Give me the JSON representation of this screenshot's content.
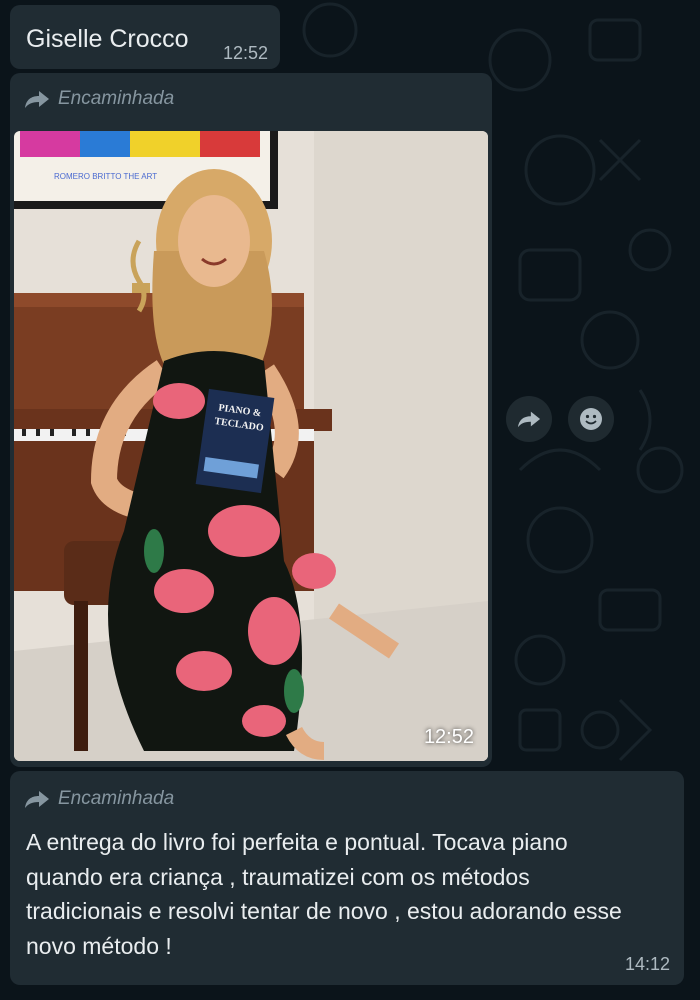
{
  "messages": [
    {
      "text": "Giselle Crocco",
      "time": "12:52"
    },
    {
      "forwarded_label": "Encaminhada",
      "media": "photo",
      "time": "12:52"
    },
    {
      "forwarded_label": "Encaminhada",
      "text": "A entrega do livro foi perfeita e pontual. Tocava piano quando era criança , traumatizei com os métodos tradicionais e resolvi tentar de novo , estou adorando esse novo método !",
      "time": "14:12"
    }
  ],
  "photo_text": {
    "book_title_line1": "PIANO &",
    "book_title_line2": "TECLADO",
    "poster_caption": "ROMERO BRITTO THE ART"
  },
  "icons": {
    "forward": "forward-arrow-icon",
    "share": "share-icon",
    "emoji": "smiley-icon"
  },
  "colors": {
    "background": "#0b141a",
    "bubble": "#202c33",
    "text": "#e9edef",
    "meta": "#8696a0"
  }
}
